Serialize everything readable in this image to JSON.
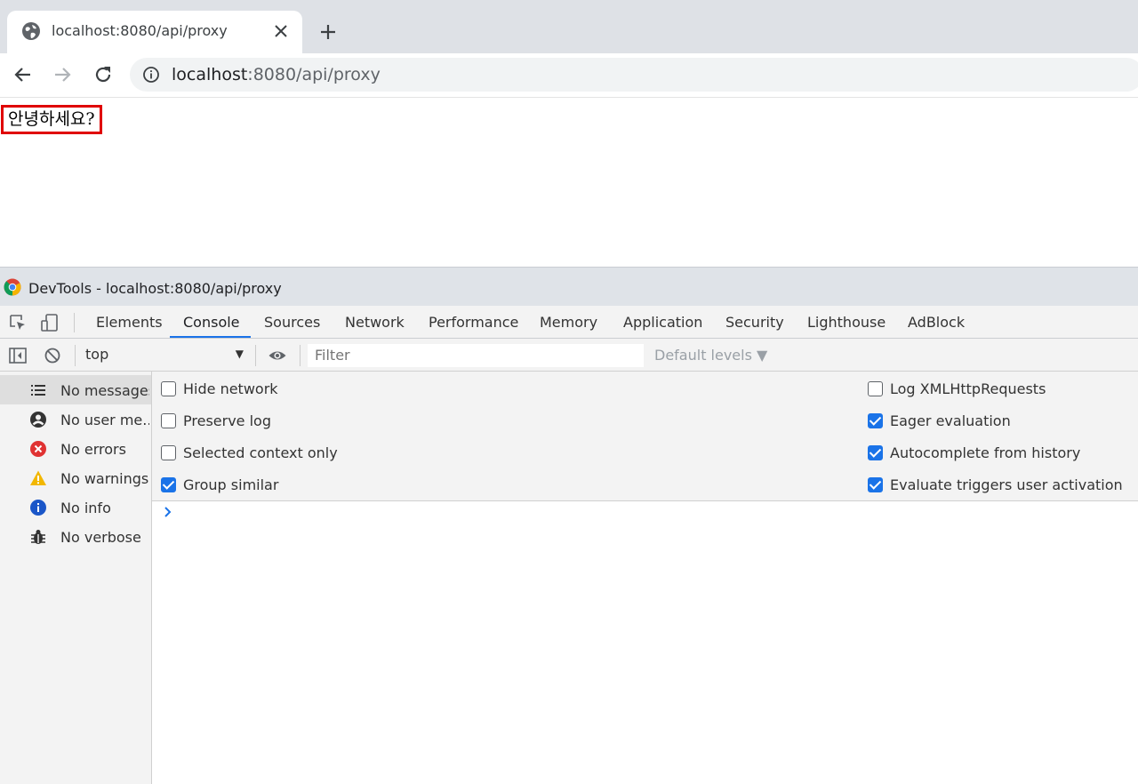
{
  "browser": {
    "tab_title": "localhost:8080/api/proxy",
    "url_host": "localhost",
    "url_rest": ":8080/api/proxy",
    "icons": {
      "favicon": "globe-icon",
      "close": "close-icon",
      "new_tab": "plus-icon",
      "back": "back-arrow-icon",
      "forward": "forward-arrow-icon",
      "reload": "reload-icon",
      "site_info": "info-icon"
    }
  },
  "page": {
    "greeting": "안녕하세요?"
  },
  "devtools": {
    "title": "DevTools - localhost:8080/api/proxy",
    "tabs": [
      "Elements",
      "Console",
      "Sources",
      "Network",
      "Performance",
      "Memory",
      "Application",
      "Security",
      "Lighthouse",
      "AdBlock"
    ],
    "active_tab": "Console",
    "console_bar": {
      "context": "top",
      "filter_placeholder": "Filter",
      "levels": "Default levels ▼"
    },
    "sidebar": [
      {
        "label": "No messages",
        "icon": "list-icon"
      },
      {
        "label": "No user me...",
        "icon": "user-icon"
      },
      {
        "label": "No errors",
        "icon": "error-icon"
      },
      {
        "label": "No warnings",
        "icon": "warning-icon"
      },
      {
        "label": "No info",
        "icon": "info-icon"
      },
      {
        "label": "No verbose",
        "icon": "bug-icon"
      }
    ],
    "settings_left": [
      {
        "label": "Hide network",
        "checked": false
      },
      {
        "label": "Preserve log",
        "checked": false
      },
      {
        "label": "Selected context only",
        "checked": false
      },
      {
        "label": "Group similar",
        "checked": true
      }
    ],
    "settings_right": [
      {
        "label": "Log XMLHttpRequests",
        "checked": false
      },
      {
        "label": "Eager evaluation",
        "checked": true
      },
      {
        "label": "Autocomplete from history",
        "checked": true
      },
      {
        "label": "Evaluate triggers user activation",
        "checked": true
      }
    ],
    "colors": {
      "accent": "#1a73e8",
      "error": "#e03232",
      "warning": "#f2b700",
      "info": "#1a56c8",
      "highlight_border": "#e00000"
    }
  }
}
